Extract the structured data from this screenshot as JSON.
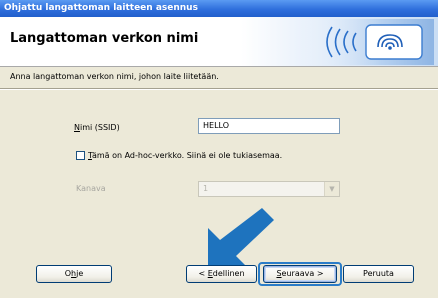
{
  "window": {
    "title": "Ohjattu langattoman laitteen asennus"
  },
  "header": {
    "title": "Langattoman verkon nimi",
    "graphic_icon": "wireless-signal-icon"
  },
  "instruction": "Anna langattoman verkon nimi, johon laite liitetään.",
  "ssid": {
    "label_hotkey": "N",
    "label_rest": "imi (SSID)",
    "value": "HELLO"
  },
  "adhoc": {
    "checked": false,
    "label_hotkey": "T",
    "label_rest": "ämä on Ad-hoc-verkko. Siinä ei ole tukiasemaa."
  },
  "channel": {
    "label": "Kanava",
    "value": "1",
    "enabled": false
  },
  "buttons": {
    "help_prefix": "O",
    "help_hotkey": "h",
    "help_suffix": "je",
    "back_prefix": "< ",
    "back_hotkey": "E",
    "back_suffix": "dellinen",
    "next_hotkey": "S",
    "next_suffix": "euraava >",
    "cancel_label": "Peruuta"
  },
  "annotation": {
    "arrow_icon": "pointer-arrow-icon",
    "color": "#1e73be"
  },
  "colors": {
    "titlebar": "#2f6fdc",
    "dialog_bg": "#ece9d8",
    "accent_blue": "#1e73be"
  }
}
